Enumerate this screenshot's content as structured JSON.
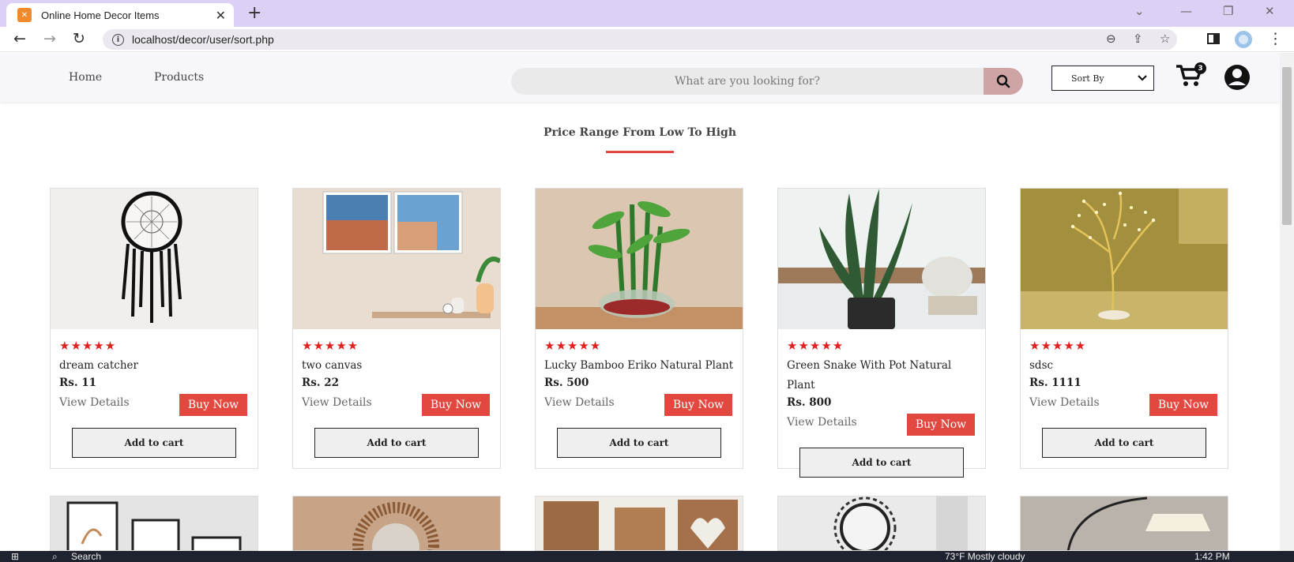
{
  "browser": {
    "tab_title": "Online Home Decor Items",
    "tab_favicon": "xampp-icon",
    "url": "localhost/decor/user/sort.php"
  },
  "header": {
    "nav": [
      "Home",
      "Products"
    ],
    "search_placeholder": "What are you looking for?",
    "sort_label": "Sort By",
    "cart_count": "3"
  },
  "section": {
    "title": "Price Range From Low To High"
  },
  "products": [
    {
      "name": "dream catcher",
      "price": "Rs. 11",
      "stars": "★★★★★",
      "view": "View Details",
      "buy": "Buy Now",
      "add": "Add to cart"
    },
    {
      "name": "two canvas",
      "price": "Rs. 22",
      "stars": "★★★★★",
      "view": "View Details",
      "buy": "Buy Now",
      "add": "Add to cart"
    },
    {
      "name": "Lucky Bamboo Eriko Natural Plant",
      "price": "Rs. 500",
      "stars": "★★★★★",
      "view": "View Details",
      "buy": "Buy Now",
      "add": "Add to cart"
    },
    {
      "name": "Green Snake With Pot Natural Plant",
      "price": "Rs. 800",
      "stars": "★★★★★",
      "view": "View Details",
      "buy": "Buy Now",
      "add": "Add to cart"
    },
    {
      "name": "sdsc",
      "price": "Rs. 1111",
      "stars": "★★★★★",
      "view": "View Details",
      "buy": "Buy Now",
      "add": "Add to cart"
    }
  ],
  "taskbar": {
    "search": "Search",
    "weather": "73°F  Mostly cloudy",
    "time": "1:42 PM"
  },
  "colors": {
    "accent_red": "#e2483f",
    "star_red": "#e22020",
    "tabbar": "#dcd0f5",
    "search_button": "#cfa4a4"
  }
}
